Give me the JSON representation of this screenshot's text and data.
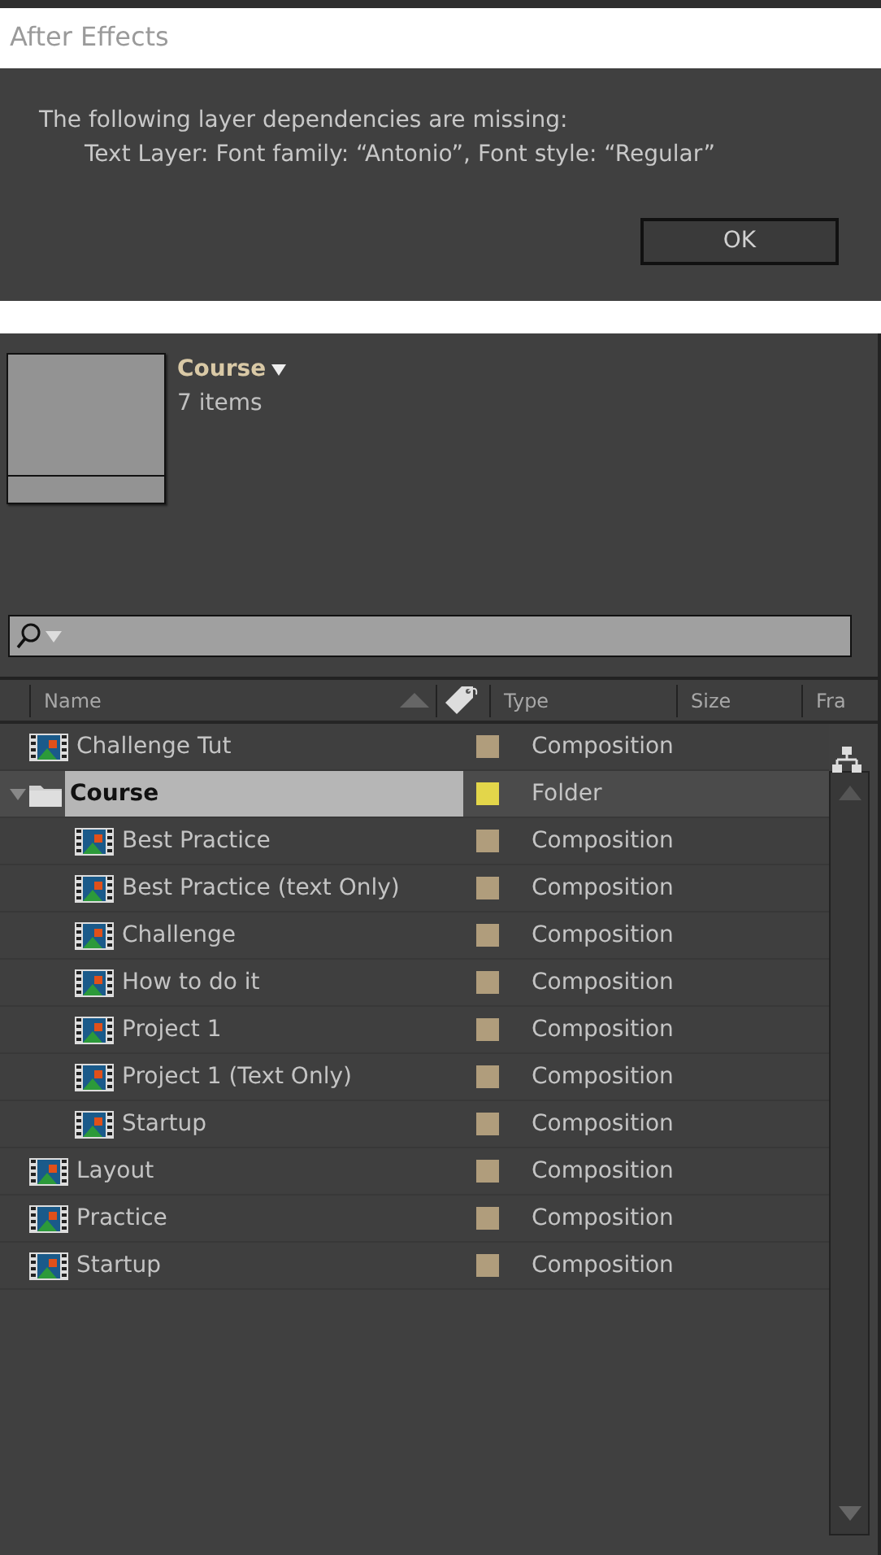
{
  "dialog": {
    "title": "After Effects",
    "message": [
      "The following layer dependencies are missing:",
      "Text Layer: Font family: “Antonio”, Font style: “Regular”"
    ],
    "buttons": [
      "OK"
    ]
  },
  "project": {
    "name": "Course",
    "count": "7 items"
  },
  "columns": [
    "Name",
    "Type",
    "Size",
    "Fra"
  ],
  "items": [
    {
      "name": "Challenge Tut",
      "type": "Composition",
      "kind": "composition",
      "color": "#b09d7c",
      "selected": false
    },
    {
      "name": "Course",
      "type": "Folder",
      "kind": "folder",
      "color": "#e3d64a",
      "selected": true,
      "expanded": true,
      "children": [
        {
          "name": "Best Practice",
          "type": "Composition",
          "kind": "composition",
          "color": "#b09d7c",
          "selected": false
        },
        {
          "name": "Best Practice (text Only)",
          "type": "Composition",
          "kind": "composition",
          "color": "#b09d7c",
          "selected": false
        },
        {
          "name": "Challenge",
          "type": "Composition",
          "kind": "composition",
          "color": "#b09d7c",
          "selected": false
        },
        {
          "name": "How to do it",
          "type": "Composition",
          "kind": "composition",
          "color": "#b09d7c",
          "selected": false
        },
        {
          "name": "Project 1",
          "type": "Composition",
          "kind": "composition",
          "color": "#b09d7c",
          "selected": false
        },
        {
          "name": "Project 1 (Text Only)",
          "type": "Composition",
          "kind": "composition",
          "color": "#b09d7c",
          "selected": false
        },
        {
          "name": "Startup",
          "type": "Composition",
          "kind": "composition",
          "color": "#b09d7c",
          "selected": false
        }
      ]
    },
    {
      "name": "Layout",
      "type": "Composition",
      "kind": "composition",
      "color": "#b09d7c",
      "selected": false
    },
    {
      "name": "Practice",
      "type": "Composition",
      "kind": "composition",
      "color": "#b09d7c",
      "selected": false
    },
    {
      "name": "Startup",
      "type": "Composition",
      "kind": "composition",
      "color": "#b09d7c",
      "selected": false
    }
  ]
}
